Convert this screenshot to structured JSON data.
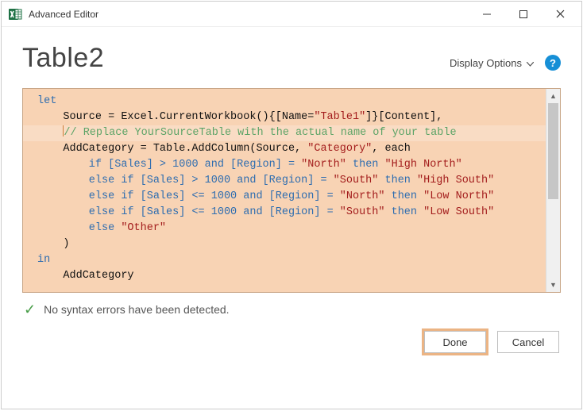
{
  "titlebar": {
    "title": "Advanced Editor"
  },
  "header": {
    "title": "Table2",
    "display_options": "Display Options",
    "help_glyph": "?"
  },
  "code": {
    "let": "let",
    "in": "in",
    "source_lhs": "    Source = Excel.CurrentWorkbook(){[Name=",
    "table1": "\"Table1\"",
    "source_rhs": "]}[Content],",
    "comment": "// Replace YourSourceTable with the actual name of your table",
    "addcat_lhs": "    AddCategory = Table.AddColumn(Source, ",
    "category": "\"Category\"",
    "addcat_rhs": ", each",
    "if1_pre": "        if [Sales] > ",
    "num1000": "1000",
    "and_region_eq": " and [Region] = ",
    "north": "\"North\"",
    "south": "\"South\"",
    "then": " then ",
    "high_north": "\"High North\"",
    "high_south": "\"High South\"",
    "low_north": "\"Low North\"",
    "low_south": "\"Low South\"",
    "elseif_gt": "        else if [Sales] > ",
    "elseif_le": "        else if [Sales] <= ",
    "else": "        else ",
    "other": "\"Other\"",
    "paren": "    )",
    "addcat_final": "    AddCategory",
    "indent": "    "
  },
  "status": {
    "text": "No syntax errors have been detected."
  },
  "buttons": {
    "done": "Done",
    "cancel": "Cancel"
  }
}
